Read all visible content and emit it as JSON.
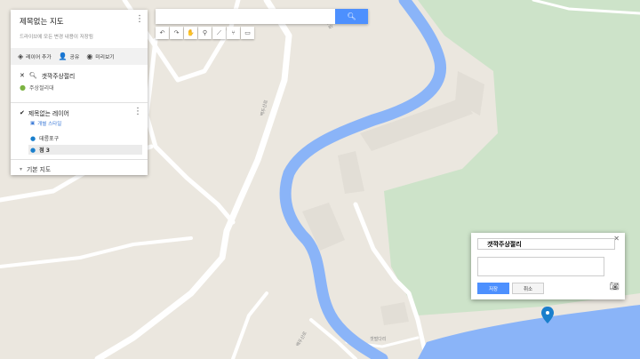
{
  "map": {
    "colors": {
      "land": "#ebe7df",
      "water": "#8ab4f8",
      "park": "#cde3c9",
      "road": "#ffffff"
    },
    "labels": [
      {
        "text": "백두산로"
      },
      {
        "text": "백두산로"
      },
      {
        "text": "골담산길"
      },
      {
        "text": "갯벌다리"
      }
    ]
  },
  "panel": {
    "title": "제목없는 지도",
    "subtitle": "드라이브에 모든 변경 내용이 저장됨",
    "toolbar": {
      "add_layer": "레이어 추가",
      "share": "공유",
      "preview": "미리보기"
    },
    "search_result_title": "갯깍주상절리",
    "search_result_place": "주상절리대",
    "layer": {
      "title": "제목없는 레이어",
      "style_link": "개별 스타일",
      "features": [
        {
          "label": "데릉포구"
        },
        {
          "label": "점 3"
        }
      ]
    },
    "base_map": "기본 지도"
  },
  "search": {
    "value": "",
    "button_icon": "search-icon"
  },
  "tools": [
    "undo-icon",
    "redo-icon",
    "hand-icon",
    "marker-icon",
    "line-icon",
    "route-icon",
    "ruler-icon"
  ],
  "popup": {
    "title_value": "갯깍주상절리",
    "description": "",
    "save_label": "저장",
    "cancel_label": "취소"
  }
}
